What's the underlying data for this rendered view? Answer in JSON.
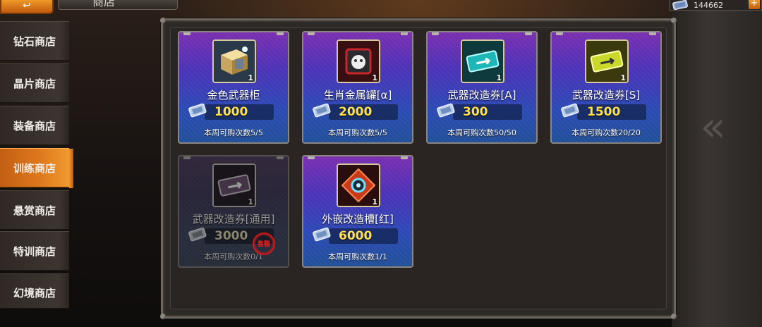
{
  "header": {
    "back_label": "↩",
    "title": "商店",
    "currency_amount": "144662",
    "add_label": "+"
  },
  "sidebar": {
    "items": [
      {
        "label": "钻石商店",
        "active": false
      },
      {
        "label": "晶片商店",
        "active": false
      },
      {
        "label": "装备商店",
        "active": false
      },
      {
        "label": "训练商店",
        "active": true
      },
      {
        "label": "悬赏商店",
        "active": false
      },
      {
        "label": "特训商店",
        "active": false
      },
      {
        "label": "幻境商店",
        "active": false
      }
    ]
  },
  "shop": {
    "items": [
      {
        "name": "金色武器柜",
        "price": "1000",
        "qty": "1",
        "limit": "本周可购次数5/5",
        "icon": "gold-weapon-crate-icon",
        "sold_out": false
      },
      {
        "name": "生肖金属罐[α]",
        "price": "2000",
        "qty": "1",
        "limit": "本周可购次数5/5",
        "icon": "zodiac-metal-canister-icon",
        "sold_out": false
      },
      {
        "name": "武器改造券[A]",
        "price": "300",
        "qty": "1",
        "limit": "本周可购次数50/50",
        "icon": "weapon-mod-ticket-a-icon",
        "sold_out": false
      },
      {
        "name": "武器改造券[S]",
        "price": "1500",
        "qty": "1",
        "limit": "本周可购次数20/20",
        "icon": "weapon-mod-ticket-s-icon",
        "sold_out": false
      },
      {
        "name": "武器改造券[通用]",
        "price": "3000",
        "qty": "1",
        "limit": "本周可购次数0/1",
        "icon": "weapon-mod-ticket-generic-icon",
        "sold_out": true,
        "stamp": "售罄"
      },
      {
        "name": "外嵌改造槽[红]",
        "price": "6000",
        "qty": "1",
        "limit": "本周可购次数1/1",
        "icon": "red-mod-slot-icon",
        "sold_out": false
      }
    ]
  },
  "colors": {
    "accent_orange": "#e07a1e",
    "price_yellow": "#ffe14a",
    "card_purple": "#7a2fb0",
    "card_blue": "#215098"
  }
}
